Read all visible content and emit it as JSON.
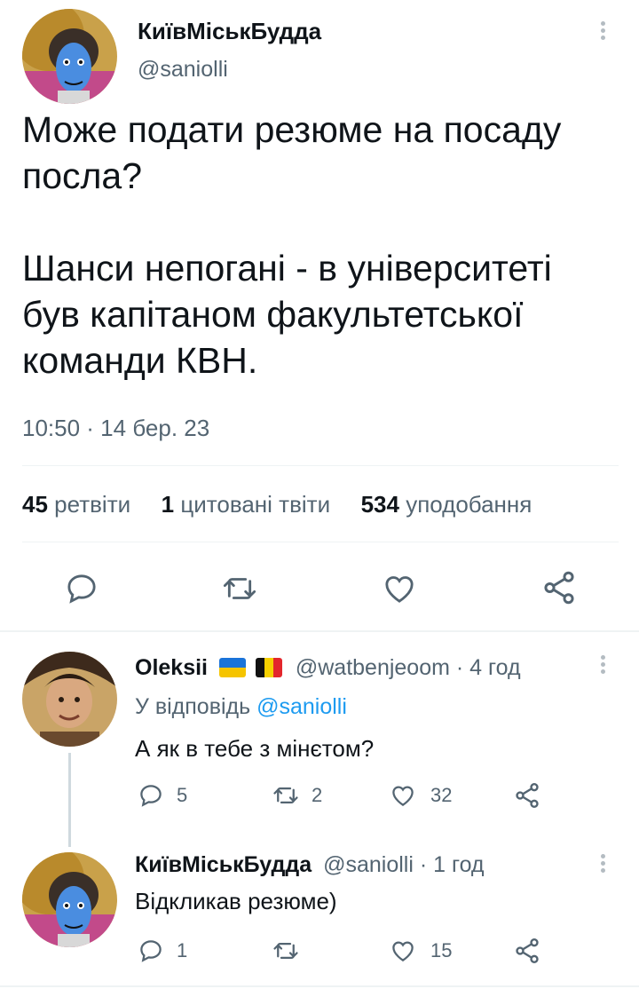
{
  "main_tweet": {
    "display_name": "КиївМіськБудда",
    "handle": "@saniolli",
    "text_line1": "Може подати резюме на посаду",
    "text_line2": "посла?",
    "text_line3": "Шанси непогані - в університеті",
    "text_line4": "був капітаном факультетської",
    "text_line5": "команди КВН.",
    "timestamp": "10:50 · 14 бер. 23",
    "stats": {
      "retweets_count": "45",
      "retweets_label": "ретвіти",
      "quotes_count": "1",
      "quotes_label": "цитовані твіти",
      "likes_count": "534",
      "likes_label": "уподобання"
    }
  },
  "reply1": {
    "display_name": "Oleksii",
    "handle": "@watbenjeoom",
    "time": "· 4 год",
    "reply_to_prefix": "У відповідь",
    "reply_to_handle": "@saniolli",
    "text": "А як в тебе з мінєтом?",
    "replies": "5",
    "retweets": "2",
    "likes": "32"
  },
  "reply2": {
    "display_name": "КиївМіськБудда",
    "handle": "@saniolli",
    "time": "· 1 год",
    "text": "Відкликав резюме)",
    "replies": "1",
    "retweets": "",
    "likes": "15"
  },
  "colors": {
    "accent": "#1d9bf0",
    "muted": "#536471",
    "border": "#eff3f4"
  },
  "icons": [
    "reply-icon",
    "retweet-icon",
    "like-icon",
    "share-icon",
    "more-icon",
    "flag-ukraine-icon",
    "flag-belgium-icon"
  ]
}
